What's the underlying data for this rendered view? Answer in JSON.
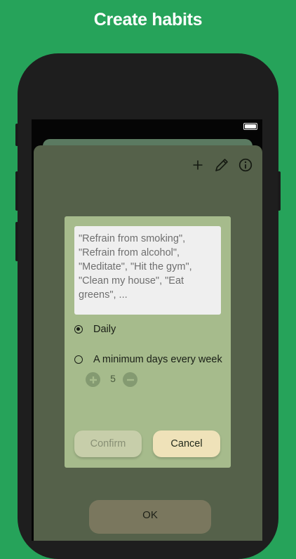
{
  "headline": "Create habits",
  "toolbar": {
    "icons": [
      "plus-icon",
      "pencil-icon",
      "info-icon"
    ]
  },
  "dialog": {
    "habit_examples": "\"Refrain from smoking\",\n\"Refrain from alcohol\",\n\"Meditate\", \"Hit the gym\",\n\"Clean my house\", \"Eat\ngreens\", ...",
    "frequency_options": [
      {
        "label": "Daily",
        "selected": true
      },
      {
        "label": "A minimum days every week",
        "selected": false
      }
    ],
    "days_per_week": "5",
    "confirm_label": "Confirm",
    "cancel_label": "Cancel"
  },
  "ok_label": "OK",
  "colors": {
    "background": "#26a35a",
    "sheet": "#55614a",
    "card": "#a6bb8c",
    "cancel_button": "#efe2b9",
    "confirm_button": "#c7ceaa",
    "ok_button": "#7a775e"
  }
}
